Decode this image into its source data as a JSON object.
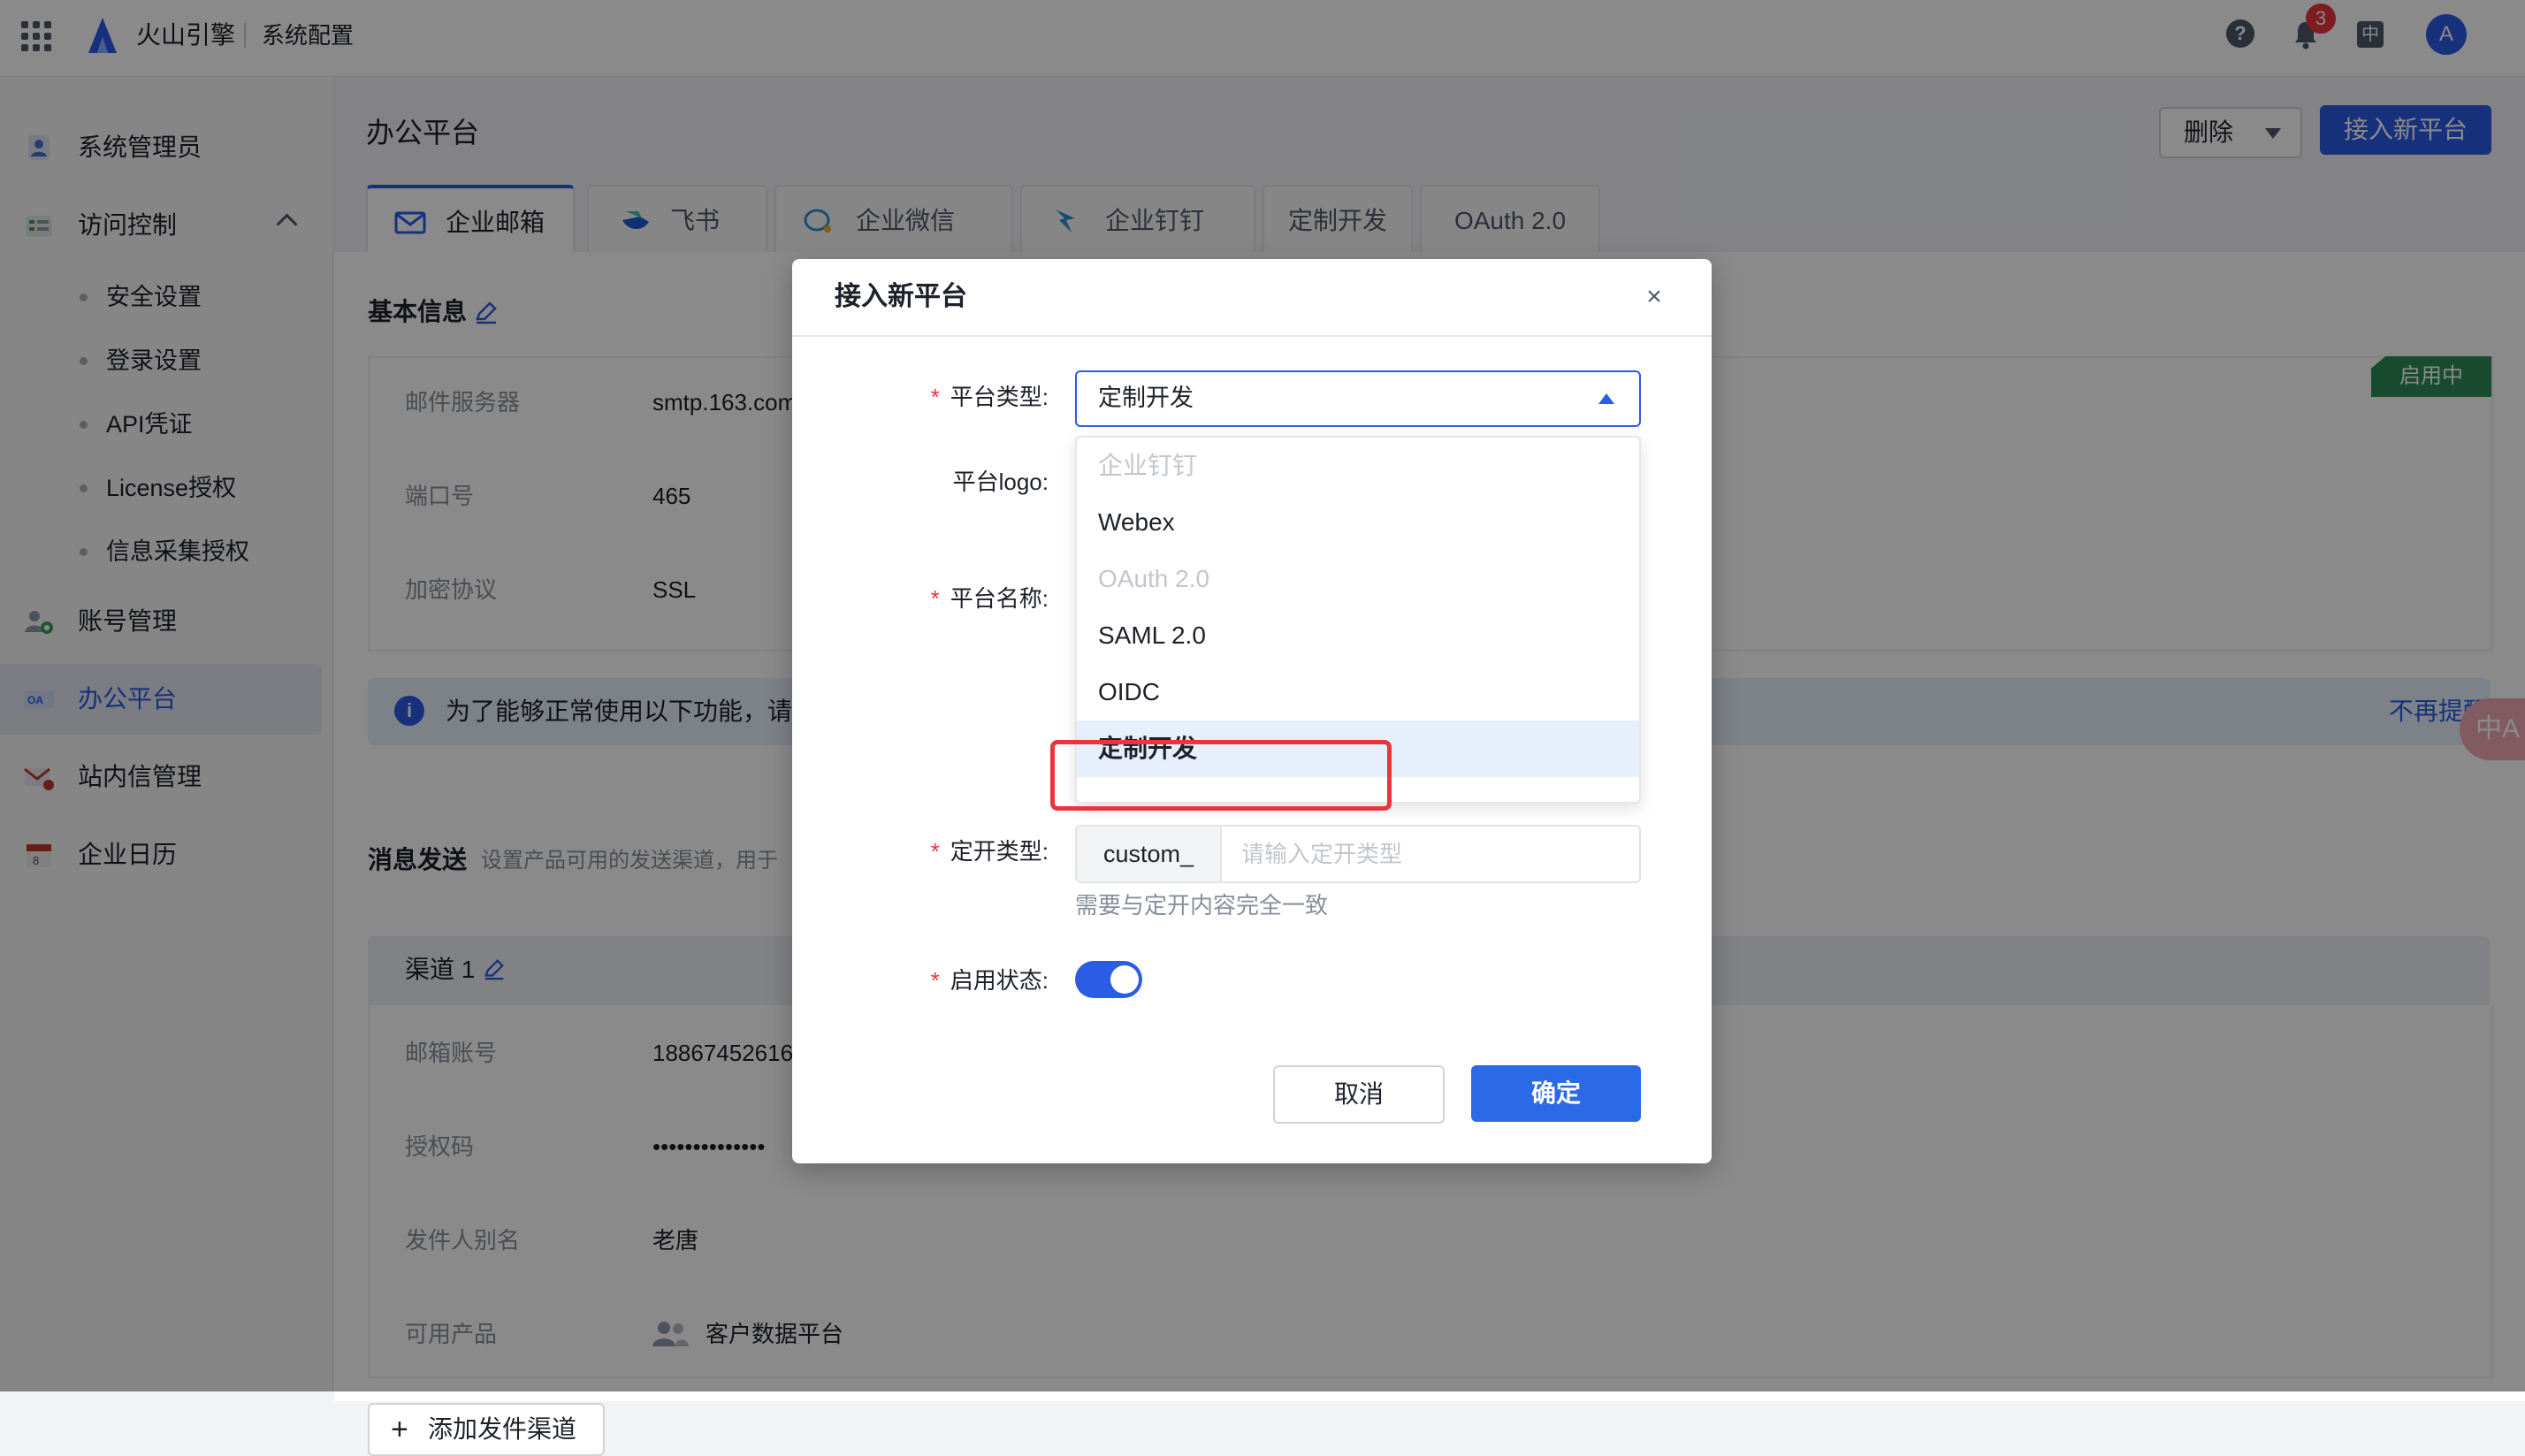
{
  "topbar": {
    "brand": "火山引擎",
    "section": "系统配置",
    "notification_count": "3",
    "lang": "中",
    "avatar": "A",
    "help": "?"
  },
  "sidebar": {
    "items": [
      {
        "label": "系统管理员",
        "icon": "admin-user-icon"
      },
      {
        "label": "访问控制",
        "icon": "access-control-icon"
      },
      {
        "label": "账号管理",
        "icon": "account-manage-icon"
      },
      {
        "label": "办公平台",
        "icon": "office-platform-icon"
      },
      {
        "label": "站内信管理",
        "icon": "mail-manage-icon"
      },
      {
        "label": "企业日历",
        "icon": "calendar-icon"
      }
    ],
    "sub_items": [
      "安全设置",
      "登录设置",
      "API凭证",
      "License授权",
      "信息采集授权"
    ]
  },
  "main": {
    "title": "办公平台",
    "delete_label": "删除",
    "new_platform_label": "接入新平台",
    "tabs": [
      "企业邮箱",
      "飞书",
      "企业微信",
      "企业钉钉",
      "定制开发",
      "OAuth 2.0"
    ],
    "basic_info_title": "基本信息",
    "status_tag": "启用中",
    "fields": [
      {
        "label": "邮件服务器",
        "value": "smtp.163.com"
      },
      {
        "label": "端口号",
        "value": "465"
      },
      {
        "label": "加密协议",
        "value": "SSL"
      }
    ],
    "info_text": "为了能够正常使用以下功能，请",
    "info_dismiss": "不再提醒",
    "message_title": "消息发送",
    "message_desc": "设置产品可用的发送渠道，用于",
    "channel_title": "渠道 1",
    "channel_fields": [
      {
        "label": "邮箱账号",
        "value": "18867452616"
      },
      {
        "label": "授权码",
        "value": "••••••••••••••"
      },
      {
        "label": "发件人别名",
        "value": "老唐"
      },
      {
        "label": "可用产品",
        "value": "客户数据平台"
      }
    ],
    "add_channel_label": "添加发件渠道"
  },
  "modal": {
    "title": "接入新平台",
    "close": "×",
    "platform_type_label": "平台类型:",
    "platform_type_value": "定制开发",
    "platform_logo_label": "平台logo:",
    "platform_name_label": "平台名称:",
    "options": [
      {
        "label": "企业钉钉",
        "state": "disabled"
      },
      {
        "label": "Webex",
        "state": "normal"
      },
      {
        "label": "OAuth 2.0",
        "state": "disabled"
      },
      {
        "label": "SAML 2.0",
        "state": "normal"
      },
      {
        "label": "OIDC",
        "state": "normal"
      },
      {
        "label": "定制开发",
        "state": "selected"
      }
    ],
    "custom_type_label": "定开类型:",
    "custom_prefix": "custom_",
    "custom_placeholder": "请输入定开类型",
    "custom_hint": "需要与定开内容完全一致",
    "enable_label": "启用状态:",
    "enabled": true,
    "cancel_label": "取消",
    "ok_label": "确定"
  },
  "translate_float": "中A",
  "colors": {
    "primary": "#2b5ce6",
    "danger": "#e8353e",
    "success": "#2e8b57"
  }
}
